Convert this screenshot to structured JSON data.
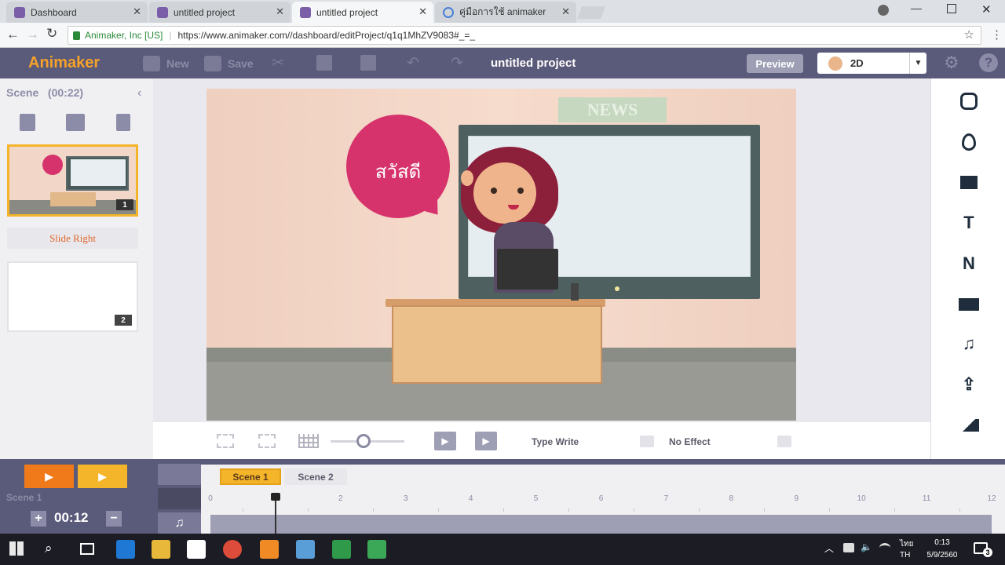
{
  "browser": {
    "tabs": [
      {
        "label": "Dashboard",
        "active": false,
        "icon": "animaker-icon"
      },
      {
        "label": "untitled project",
        "active": false,
        "icon": "animaker-icon"
      },
      {
        "label": "untitled project",
        "active": true,
        "icon": "animaker-icon"
      },
      {
        "label": "คู่มือการใช้ animaker - ค้น",
        "active": false,
        "icon": "google-icon"
      }
    ],
    "site_identity": "Animaker, Inc [US]",
    "url": "https://www.animaker.com//dashboard/editProject/q1q1MhZV9083#_=_"
  },
  "header": {
    "logo": "Animaker",
    "new_label": "New",
    "save_label": "Save",
    "project_title": "untitled project",
    "preview_label": "Preview",
    "mode_label": "2D"
  },
  "scene_panel": {
    "title": "Scene",
    "duration": "(00:22)",
    "thumbs": [
      {
        "number": "1",
        "selected": true
      },
      {
        "number": "2",
        "selected": false
      }
    ],
    "transition_label": "Slide Right"
  },
  "stage": {
    "speech_text": "สวัสดี",
    "sign_text": "NEWS"
  },
  "controls": {
    "zoom_level": 0.45,
    "text_effect_label": "Type Write",
    "effect_label": "No Effect"
  },
  "timeline": {
    "current_scene": "Scene 1",
    "time": "00:12",
    "scene_tabs": [
      "Scene 1",
      "Scene 2"
    ],
    "ticks": [
      "0",
      "1",
      "2",
      "3",
      "4",
      "5",
      "6",
      "7",
      "8",
      "9",
      "10",
      "11",
      "12"
    ],
    "playhead_value": 1
  },
  "taskbar": {
    "language": "TH",
    "ime": "ไทย",
    "time": "0:13",
    "date": "5/9/2560",
    "notification_count": "3"
  },
  "colors": {
    "header_bg": "#5a5a7a",
    "accent_orange": "#f07a1a",
    "accent_yellow": "#f5b52a",
    "speech_bubble": "#d6336c"
  }
}
